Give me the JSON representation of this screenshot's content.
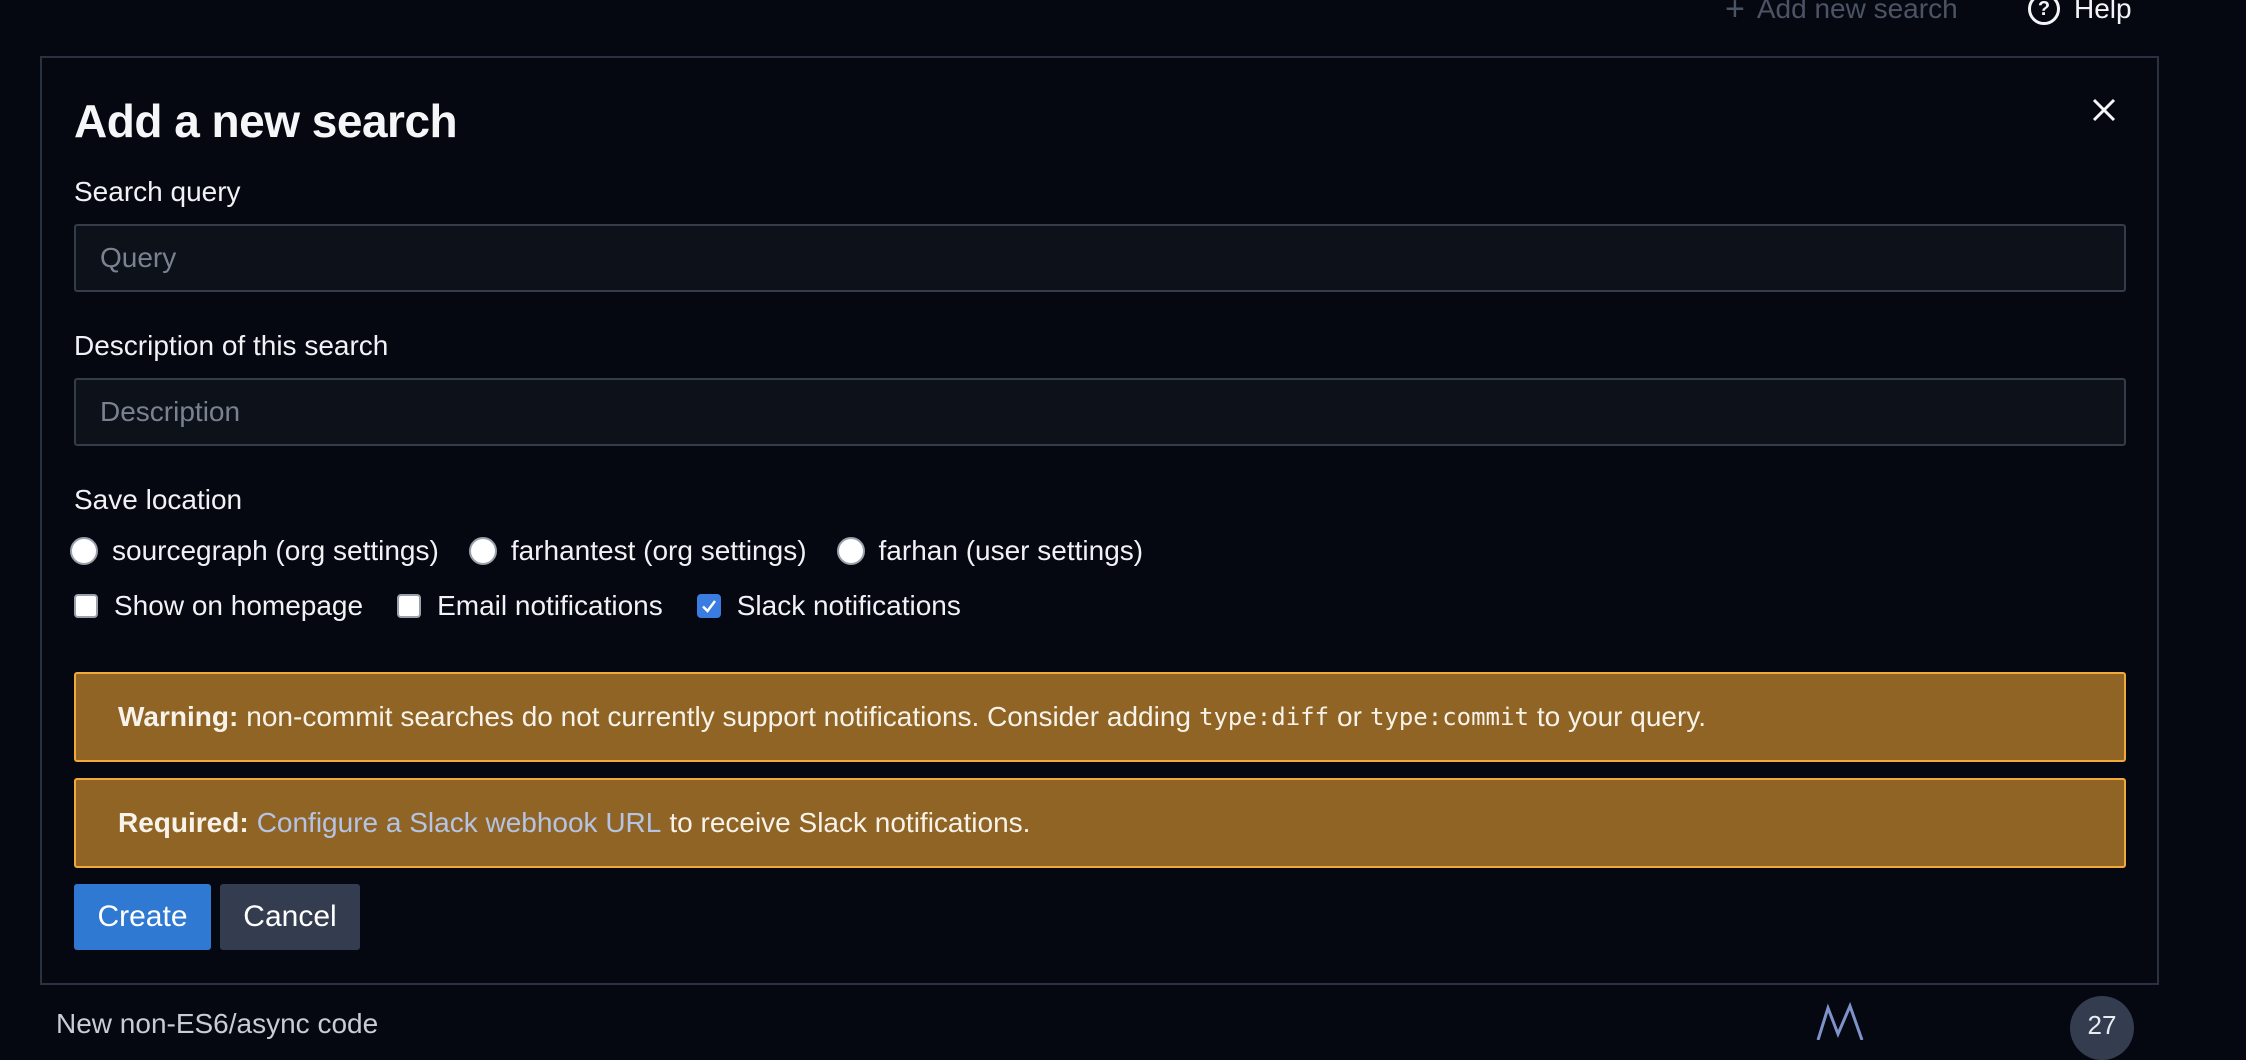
{
  "topbar": {
    "add_new_search_label": "Add new search",
    "help_label": "Help"
  },
  "modal": {
    "title": "Add a new search",
    "query_label": "Search query",
    "query_placeholder": "Query",
    "query_value": "",
    "description_label": "Description of this search",
    "description_placeholder": "Description",
    "description_value": "",
    "save_location_label": "Save location",
    "save_locations": [
      {
        "label": "sourcegraph (org settings)",
        "selected": false
      },
      {
        "label": "farhantest (org settings)",
        "selected": false
      },
      {
        "label": "farhan (user settings)",
        "selected": false
      }
    ],
    "options": [
      {
        "label": "Show on homepage",
        "checked": false
      },
      {
        "label": "Email notifications",
        "checked": false
      },
      {
        "label": "Slack notifications",
        "checked": true
      }
    ],
    "warning": {
      "prefix": "Warning:",
      "text_before": "non-commit searches do not currently support notifications. Consider adding",
      "code1": "type:diff",
      "middle": "or",
      "code2": "type:commit",
      "text_after": "to your query."
    },
    "required": {
      "prefix": "Required:",
      "link": "Configure a Slack webhook URL",
      "text_after": "to receive Slack notifications."
    },
    "create_label": "Create",
    "cancel_label": "Cancel"
  },
  "background_list": {
    "row_title": "New non-ES6/async code",
    "count": "27"
  },
  "colors": {
    "background": "#050810",
    "alert_bg": "#8f6425",
    "alert_border": "#f0a93a",
    "primary": "#2f79d3",
    "secondary": "#343c4f",
    "link": "#b5c4e4"
  }
}
